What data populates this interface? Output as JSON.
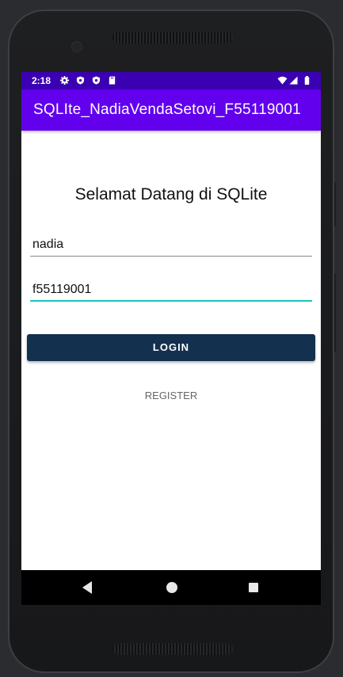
{
  "status_bar": {
    "time": "2:18",
    "icons": [
      "gear-icon",
      "shield-icon",
      "shield-icon",
      "sd-card-icon",
      "wifi-icon",
      "signal-icon",
      "battery-icon"
    ]
  },
  "app_bar": {
    "title": "SQLIte_NadiaVendaSetovi_F55119001",
    "color": "#6200ee"
  },
  "main": {
    "welcome": "Selamat Datang di SQLite",
    "username_value": "nadia",
    "password_value": "f55119001",
    "login_label": "LOGIN",
    "register_label": "REGISTER"
  },
  "nav_bar": {
    "icons": [
      "back-icon",
      "home-icon",
      "recents-icon"
    ]
  },
  "colors": {
    "status_bar": "#3c00b3",
    "login_button": "#14304f",
    "focus_underline": "#16c7c2"
  }
}
